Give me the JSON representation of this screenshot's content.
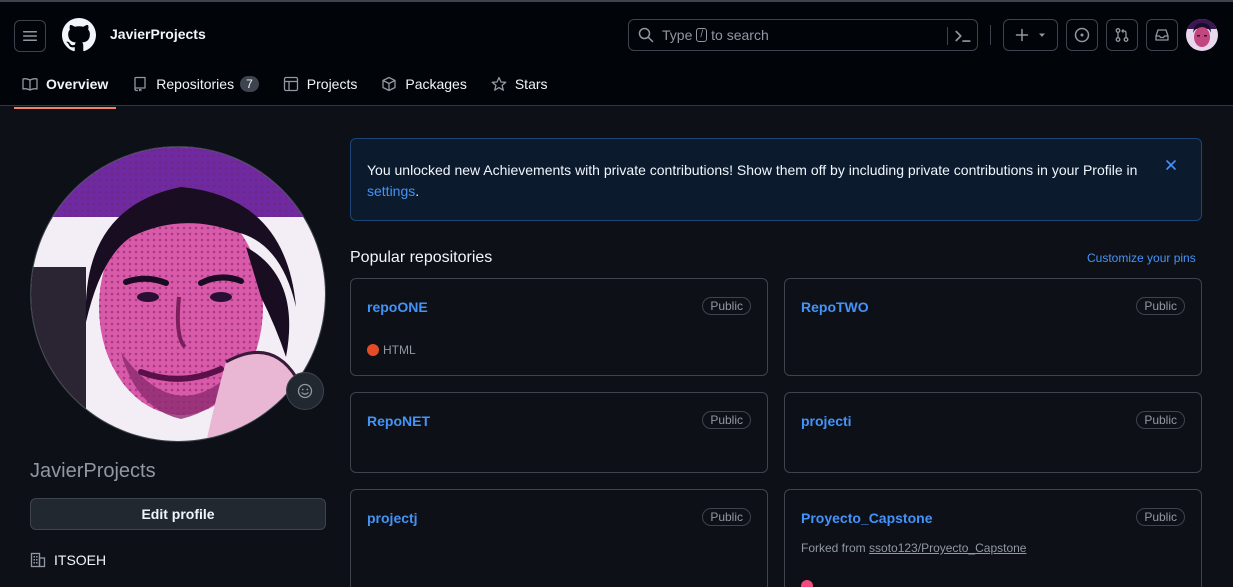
{
  "header": {
    "username": "JavierProjects",
    "search": {
      "prefix": "Type",
      "key": "/",
      "suffix": "to search"
    }
  },
  "tabs": [
    {
      "label": "Overview",
      "icon": "book-icon",
      "active": true
    },
    {
      "label": "Repositories",
      "icon": "repo-icon",
      "count": "7"
    },
    {
      "label": "Projects",
      "icon": "table-icon"
    },
    {
      "label": "Packages",
      "icon": "package-icon"
    },
    {
      "label": "Stars",
      "icon": "star-icon"
    }
  ],
  "profile": {
    "name": "JavierProjects",
    "edit_label": "Edit profile",
    "organization": "ITSOEH"
  },
  "flash": {
    "text_before": "You unlocked new Achievements with private contributions! Show them off by including private contributions in your Profile in ",
    "link": "settings",
    "text_after": "."
  },
  "popular": {
    "title": "Popular repositories",
    "customize": "Customize your pins",
    "repos": [
      {
        "name": "repoONE",
        "visibility": "Public",
        "language": "HTML",
        "language_color": "#e34c26"
      },
      {
        "name": "RepoTWO",
        "visibility": "Public"
      },
      {
        "name": "RepoNET",
        "visibility": "Public"
      },
      {
        "name": "projecti",
        "visibility": "Public"
      },
      {
        "name": "projectj",
        "visibility": "Public"
      },
      {
        "name": "Proyecto_Capstone",
        "visibility": "Public",
        "forked_prefix": "Forked from",
        "forked_from": "ssoto123/Proyecto_Capstone",
        "language_color": "#f34b7d"
      }
    ]
  },
  "colors": {
    "accent": "#4493f8",
    "tab_underline": "#f78166",
    "background": "#0d1117",
    "header_bg": "#010409"
  }
}
